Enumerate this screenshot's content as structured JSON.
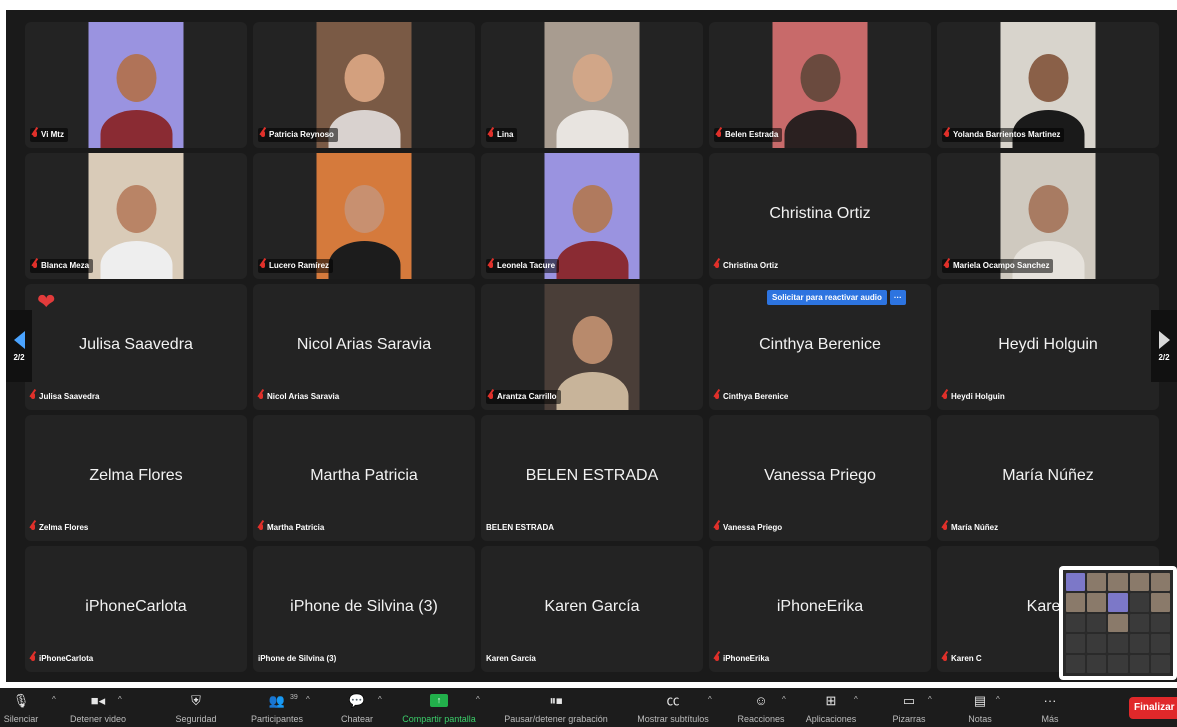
{
  "tiles": [
    {
      "label": "Vi Mtz",
      "kind": "video",
      "muted": true,
      "bg": "#9a93e0",
      "skin": "#b07358",
      "shirt": "#8a2b33"
    },
    {
      "label": "Patricia Reynoso",
      "kind": "video",
      "muted": true,
      "bg": "#7a5a45",
      "skin": "#d3a07e",
      "shirt": "#d9d2cf"
    },
    {
      "label": "Lina",
      "kind": "video",
      "muted": true,
      "bg": "#a89c90",
      "skin": "#d1a688",
      "shirt": "#e8e4e0"
    },
    {
      "label": "Belen Estrada",
      "kind": "video",
      "muted": true,
      "bg": "#c86a6a",
      "skin": "#6a4a3e",
      "shirt": "#2a2020"
    },
    {
      "label": "Yolanda Barrientos Martinez",
      "kind": "video",
      "muted": true,
      "bg": "#d8d4cc",
      "skin": "#8a6048",
      "shirt": "#1a1a1a"
    },
    {
      "label": "Blanca Meza",
      "kind": "video",
      "muted": true,
      "bg": "#d9cbb8",
      "skin": "#b98466",
      "shirt": "#eeeeee"
    },
    {
      "label": "Lucero Ramírez",
      "kind": "video",
      "muted": true,
      "bg": "#d57a3c",
      "skin": "#c89070",
      "shirt": "#1c1c1c"
    },
    {
      "label": "Leonela Tacure",
      "kind": "video",
      "muted": true,
      "bg": "#9a93e0",
      "skin": "#b07a5e",
      "shirt": "#8a2b33"
    },
    {
      "label": "Christina Ortiz",
      "kind": "name",
      "muted": true,
      "display": "Christina Ortiz"
    },
    {
      "label": "Mariela Ocampo Sanchez",
      "kind": "video",
      "muted": true,
      "bg": "#cfc9bf",
      "skin": "#a87b62",
      "shirt": "#e6e2dc"
    },
    {
      "label": "Julisa Saavedra",
      "kind": "name",
      "muted": true,
      "display": "Julisa Saavedra",
      "heart": true
    },
    {
      "label": "Nicol Arias Saravia",
      "kind": "name",
      "muted": true,
      "display": "Nicol Arias Saravia"
    },
    {
      "label": "Arantza Carrillo",
      "kind": "video",
      "muted": true,
      "bg": "#4a3e38",
      "skin": "#b88a6c",
      "shirt": "#c8b49a"
    },
    {
      "label": "Cinthya Berenice",
      "kind": "name",
      "muted": true,
      "display": "Cinthya Berenice",
      "reactivate": true
    },
    {
      "label": "Heydi Holguin",
      "kind": "name",
      "muted": true,
      "display": "Heydi Holguin"
    },
    {
      "label": "Zelma Flores",
      "kind": "name",
      "muted": true,
      "display": "Zelma Flores"
    },
    {
      "label": "Martha Patricia",
      "kind": "name",
      "muted": true,
      "display": "Martha Patricia"
    },
    {
      "label": "BELEN ESTRADA",
      "kind": "name",
      "muted": false,
      "display": "BELEN ESTRADA"
    },
    {
      "label": "Vanessa Priego",
      "kind": "name",
      "muted": true,
      "display": "Vanessa Priego"
    },
    {
      "label": "María Núñez",
      "kind": "name",
      "muted": true,
      "display": "María Núñez"
    },
    {
      "label": "iPhoneCarlota",
      "kind": "name",
      "muted": true,
      "display": "iPhoneCarlota"
    },
    {
      "label": "iPhone de Silvina (3)",
      "kind": "name",
      "muted": false,
      "display": "iPhone de Silvina (3)"
    },
    {
      "label": "Karen García",
      "kind": "name",
      "muted": false,
      "display": "Karen García"
    },
    {
      "label": "iPhoneErika",
      "kind": "name",
      "muted": true,
      "display": "iPhoneErika"
    },
    {
      "label": "Karen C",
      "kind": "name",
      "muted": true,
      "display": "Karen"
    }
  ],
  "reactivate_audio": {
    "label": "Solicitar para reactivar audio",
    "more": "···"
  },
  "pager": {
    "left": "2/2",
    "right": "2/2"
  },
  "toolbar": {
    "mute": "Silenciar",
    "video": "Detener video",
    "security": "Seguridad",
    "participants": "Participantes",
    "participants_count": "39",
    "chat": "Chatear",
    "share": "Compartir pantalla",
    "record": "Pausar/detener grabación",
    "captions": "Mostrar subtítulos",
    "reactions": "Reacciones",
    "apps": "Aplicaciones",
    "whiteboards": "Pizarras",
    "notes": "Notas",
    "more": "Más",
    "end": "Finalizar"
  },
  "colors": {
    "background": "#1a1a1a",
    "tile": "#232323",
    "accent": "#2d74e0",
    "share_green": "#22b04b",
    "end_red": "#e0282a",
    "muted_red": "#e0302a"
  }
}
